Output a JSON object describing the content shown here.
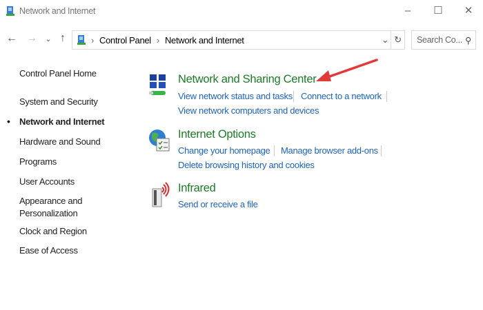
{
  "window": {
    "title": "Network and Internet",
    "minimize": "–",
    "maximize": "☐",
    "close": "✕"
  },
  "toolbar": {
    "back": "←",
    "forward": "→",
    "recent": "⌄",
    "up": "↑",
    "breadcrumb": [
      "Control Panel",
      "Network and Internet"
    ],
    "crumb_sep": "›",
    "dropdown": "⌄",
    "refresh": "↻",
    "search_placeholder": "Search Co...",
    "search_icon": "⚲"
  },
  "sidebar": {
    "items": [
      {
        "label": "Control Panel Home"
      },
      {
        "label": "System and Security"
      },
      {
        "label": "Network and Internet",
        "active": true,
        "bullet": "•"
      },
      {
        "label": "Hardware and Sound"
      },
      {
        "label": "Programs"
      },
      {
        "label": "User Accounts"
      },
      {
        "label": "Appearance and Personalization"
      },
      {
        "label": "Clock and Region"
      },
      {
        "label": "Ease of Access"
      }
    ]
  },
  "sections": [
    {
      "title": "Network and Sharing Center",
      "icon": "network-icon",
      "links": [
        "View network status and tasks",
        "Connect to a network",
        "View network computers and devices"
      ]
    },
    {
      "title": "Internet Options",
      "icon": "globe-checklist-icon",
      "links": [
        "Change your homepage",
        "Manage browser add-ons",
        "Delete browsing history and cookies"
      ]
    },
    {
      "title": "Infrared",
      "icon": "infrared-icon",
      "links": [
        "Send or receive a file"
      ]
    }
  ],
  "colors": {
    "heading": "#1e7a28",
    "link": "#1f63b8",
    "arrow": "#e03a3a"
  }
}
